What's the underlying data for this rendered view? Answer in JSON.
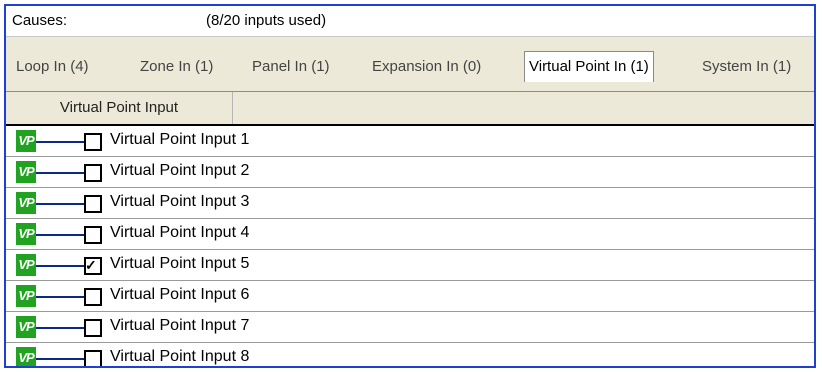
{
  "header": {
    "causes_label": "Causes:",
    "usage_text": "(8/20 inputs used)"
  },
  "tabs": [
    {
      "label": "Loop In (4)",
      "active": false
    },
    {
      "label": "Zone In (1)",
      "active": false
    },
    {
      "label": "Panel In (1)",
      "active": false
    },
    {
      "label": "Expansion In (0)",
      "active": false
    },
    {
      "label": "Virtual Point In (1)",
      "active": true
    },
    {
      "label": "System In (1)",
      "active": false
    }
  ],
  "column_header": "Virtual Point Input",
  "rows": [
    {
      "icon": "VP",
      "label": "Virtual Point Input 1",
      "checked": false
    },
    {
      "icon": "VP",
      "label": "Virtual Point Input 2",
      "checked": false
    },
    {
      "icon": "VP",
      "label": "Virtual Point Input 3",
      "checked": false
    },
    {
      "icon": "VP",
      "label": "Virtual Point Input 4",
      "checked": false
    },
    {
      "icon": "VP",
      "label": "Virtual Point Input 5",
      "checked": true
    },
    {
      "icon": "VP",
      "label": "Virtual Point Input 6",
      "checked": false
    },
    {
      "icon": "VP",
      "label": "Virtual Point Input 7",
      "checked": false
    },
    {
      "icon": "VP",
      "label": "Virtual Point Input 8",
      "checked": false
    }
  ],
  "colors": {
    "frame": "#1f3fd6",
    "vp_icon": "#21a221",
    "connector": "#0a2a8a",
    "tabbar": "#ece9d8"
  }
}
